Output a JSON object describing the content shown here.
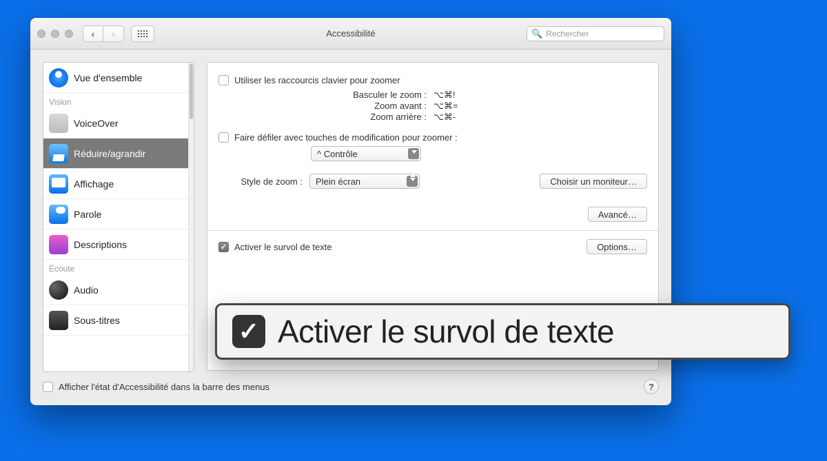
{
  "window": {
    "title": "Accessibilité",
    "search_placeholder": "Rechercher"
  },
  "sidebar": {
    "items": [
      {
        "label": "Vue d'ensemble"
      }
    ],
    "vision_header": "Vision",
    "vision_items": [
      {
        "label": "VoiceOver"
      },
      {
        "label": "Réduire/agrandir"
      },
      {
        "label": "Affichage"
      },
      {
        "label": "Parole"
      },
      {
        "label": "Descriptions"
      }
    ],
    "ecoute_header": "Écoute",
    "ecoute_items": [
      {
        "label": "Audio"
      },
      {
        "label": "Sous-titres"
      }
    ]
  },
  "main": {
    "use_keyboard": "Utiliser les raccourcis clavier pour zoomer",
    "sc_toggle_label": "Basculer le zoom :",
    "sc_toggle_keys": "⌥⌘!",
    "sc_in_label": "Zoom avant :",
    "sc_in_keys": "⌥⌘=",
    "sc_out_label": "Zoom arrière :",
    "sc_out_keys": "⌥⌘-",
    "scroll_mod": "Faire défiler avec touches de modification pour zoomer :",
    "modkey": "^ Contrôle",
    "zoom_style_label": "Style de zoom :",
    "zoom_style_value": "Plein écran",
    "choose_monitor": "Choisir un moniteur…",
    "advanced": "Avancé…",
    "hover_text": "Activer le survol de texte",
    "options": "Options…"
  },
  "footer": {
    "menubar": "Afficher l'état d'Accessibilité dans la barre des menus",
    "help": "?"
  },
  "overlay": {
    "text": "Activer le survol de texte"
  }
}
